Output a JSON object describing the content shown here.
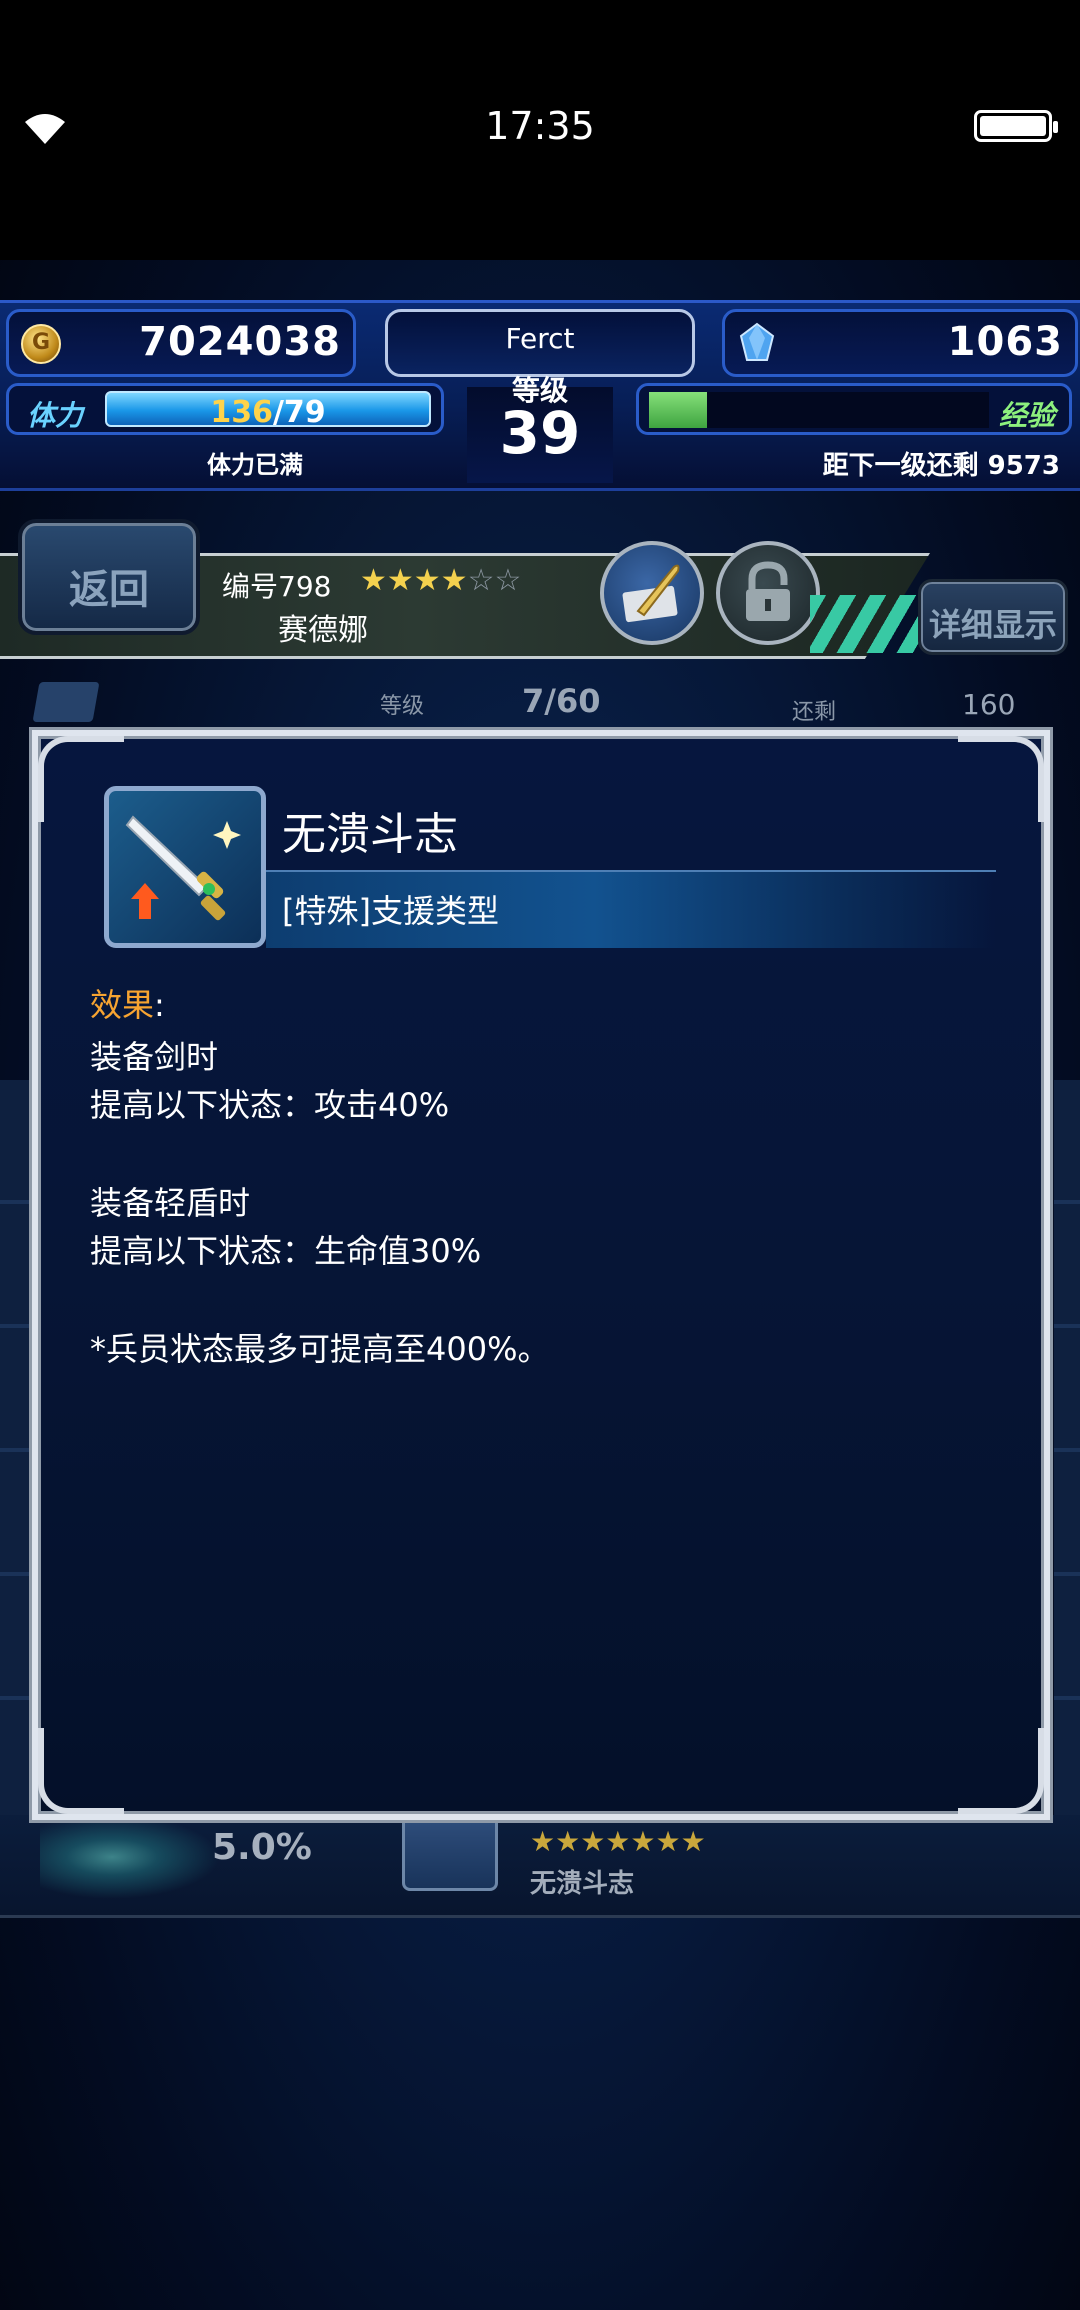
{
  "status_bar": {
    "time": "17:35"
  },
  "header": {
    "gil": "7024038",
    "lapis": "1063",
    "player_name": "Ferct",
    "level_label": "等级",
    "level": "39",
    "stamina_label": "体力",
    "stamina_current": "136",
    "stamina_max": "/79",
    "stamina_status": "体力已满",
    "exp_label": "经验",
    "exp_remaining": "距下一级还剩 9573",
    "exp_fraction": 0.17
  },
  "unit_bar": {
    "back_label": "返回",
    "unit_number": "编号798",
    "stars_filled": "★★★★",
    "stars_empty": "☆☆",
    "unit_name": "赛德娜",
    "detail_label": "详细显示"
  },
  "background": {
    "level_label": "等级",
    "level_value": "7/60",
    "remaining_label": "还剩",
    "remaining_value": "160",
    "bottom_rate": "5.0%",
    "bottom_stars": "★★★★★★★",
    "bottom_name": "无溃斗志"
  },
  "modal": {
    "ability_name": "无溃斗志",
    "ability_type": "[特殊]支援类型",
    "effect_label": "效果",
    "effect_colon": ":",
    "lines": [
      "装备剑时",
      "提高以下状态：攻击40%",
      "装备轻盾时",
      "提高以下状态：生命值30%",
      "*兵员状态最多可提高至400%。"
    ]
  },
  "colors": {
    "accent_orange": "#f7a431",
    "stamina_value": "#ffd34a",
    "exp_green": "#8df07d"
  }
}
